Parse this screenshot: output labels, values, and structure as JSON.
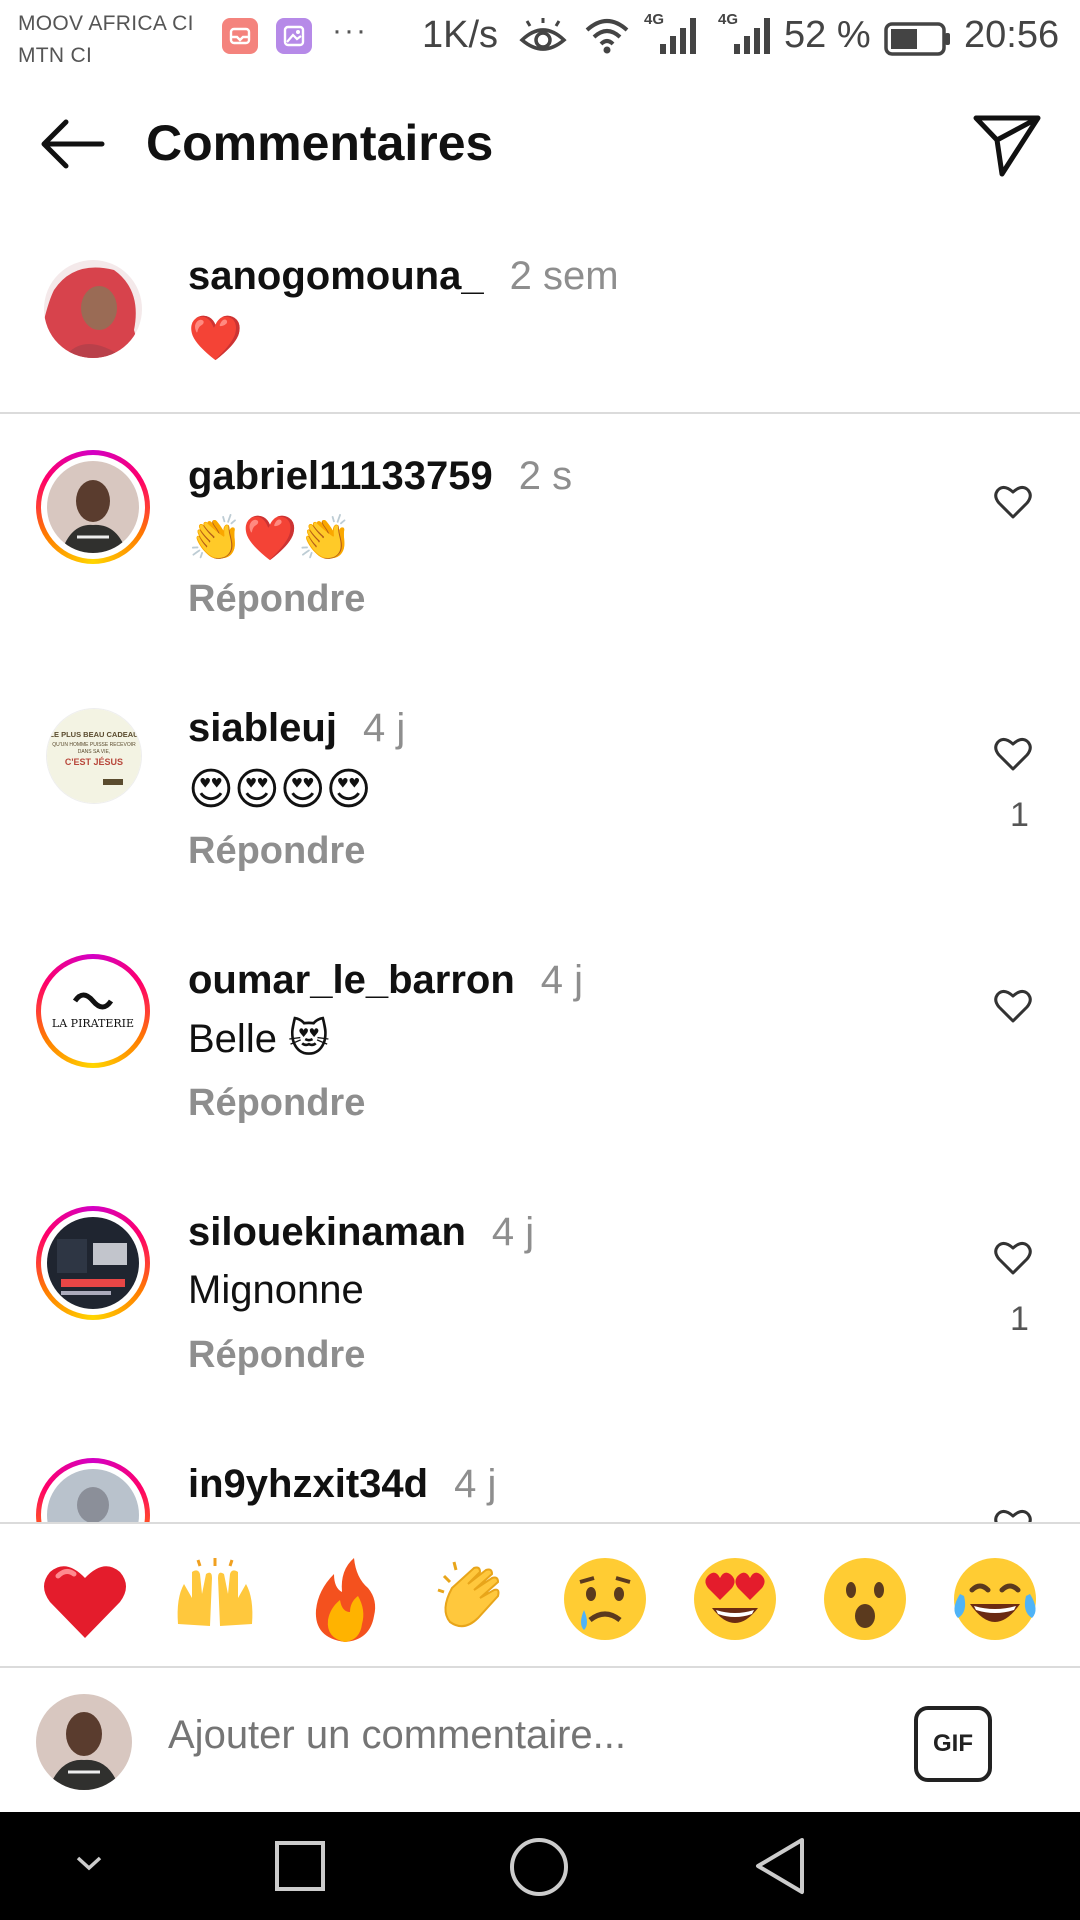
{
  "status_bar": {
    "carrier_line1": "MOOV AFRICA CI",
    "carrier_line2": "MTN CI",
    "more": "···",
    "net_speed": "1K/s",
    "signal1_label": "4G",
    "signal2_label": "4G",
    "battery": "52 %",
    "time": "20:56"
  },
  "header": {
    "title": "Commentaires",
    "back_icon": "arrow-left-icon",
    "share_icon": "send-icon"
  },
  "caption": {
    "username": "sanogomouna_",
    "time": "2 sem",
    "text": "❤️"
  },
  "comments": [
    {
      "username": "gabriel11133759",
      "time": "2 s",
      "text": "👏❤️👏",
      "reply": "Répondre",
      "likes": ""
    },
    {
      "username": "siableuj",
      "time": "4 j",
      "text": "😍😍😍😍",
      "reply": "Répondre",
      "likes": "1"
    },
    {
      "username": "oumar_le_barron",
      "time": "4 j",
      "text": "Belle 😻",
      "reply": "Répondre",
      "likes": ""
    },
    {
      "username": "silouekinaman",
      "time": "4 j",
      "text": "Mignonne",
      "reply": "Répondre",
      "likes": "1"
    },
    {
      "username": "in9yhzxit34d",
      "time": "4 j",
      "text": "",
      "reply": "",
      "likes": ""
    }
  ],
  "avatar_texts": {
    "siableuj": [
      "LE PLUS BEAU CADEAU",
      "QU'UN HOMME PUISSE RECEVOIR",
      "DANS SA VIE,",
      "C'EST JÉSUS"
    ],
    "oumar": "LA PIRATERIE"
  },
  "emoji_bar": [
    "❤️",
    "🙌",
    "🔥",
    "👏",
    "😢",
    "😍",
    "😮",
    "😂"
  ],
  "compose": {
    "placeholder": "Ajouter un commentaire...",
    "gif_label": "GIF"
  },
  "navbar": [
    "chevron-down-icon",
    "square-icon",
    "circle-icon",
    "triangle-back-icon"
  ]
}
